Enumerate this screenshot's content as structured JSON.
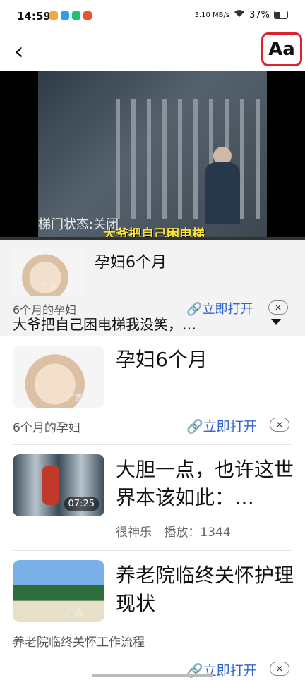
{
  "status_bar": {
    "time": "14:59",
    "network_speed": "3.10 MB/s",
    "battery": "37%",
    "battery_level": 0.37
  },
  "nav": {
    "back_glyph": "‹",
    "font_button_label": "Aa"
  },
  "video": {
    "overlay_status": "梯门状态:关闭",
    "caption": "大爷把自己困电梯",
    "progress": 0.0
  },
  "overlay_ad": {
    "title": "孕妇6个月",
    "ad_badge": "广告",
    "subtitle": "6个月的孕妇",
    "open_label": "立即打开",
    "close_glyph": "×",
    "article_title": "大爷把自己困电梯我没笑，…"
  },
  "feed": [
    {
      "title": "孕妇6个月",
      "ad_badge": "广告",
      "subtitle": "6个月的孕妇",
      "open_label": "立即打开",
      "close_glyph": "×"
    },
    {
      "title": "大胆一点，也许这世界本该如此：…",
      "duration": "07:25",
      "author": "很神乐",
      "plays": "播放：1344"
    },
    {
      "title": "养老院临终关怀护理现状",
      "ad_badge": "广告",
      "subtitle": "养老院临终关怀工作流程",
      "open_label": "立即打开",
      "close_glyph": "×"
    }
  ],
  "colors": {
    "accent_link": "#3366cc",
    "highlight_red": "#d9232d",
    "caption_yellow": "#f7e13a"
  },
  "icons": [
    "back-icon",
    "link-icon",
    "close-icon",
    "dropdown-triangle-icon",
    "wifi-icon",
    "battery-icon"
  ]
}
